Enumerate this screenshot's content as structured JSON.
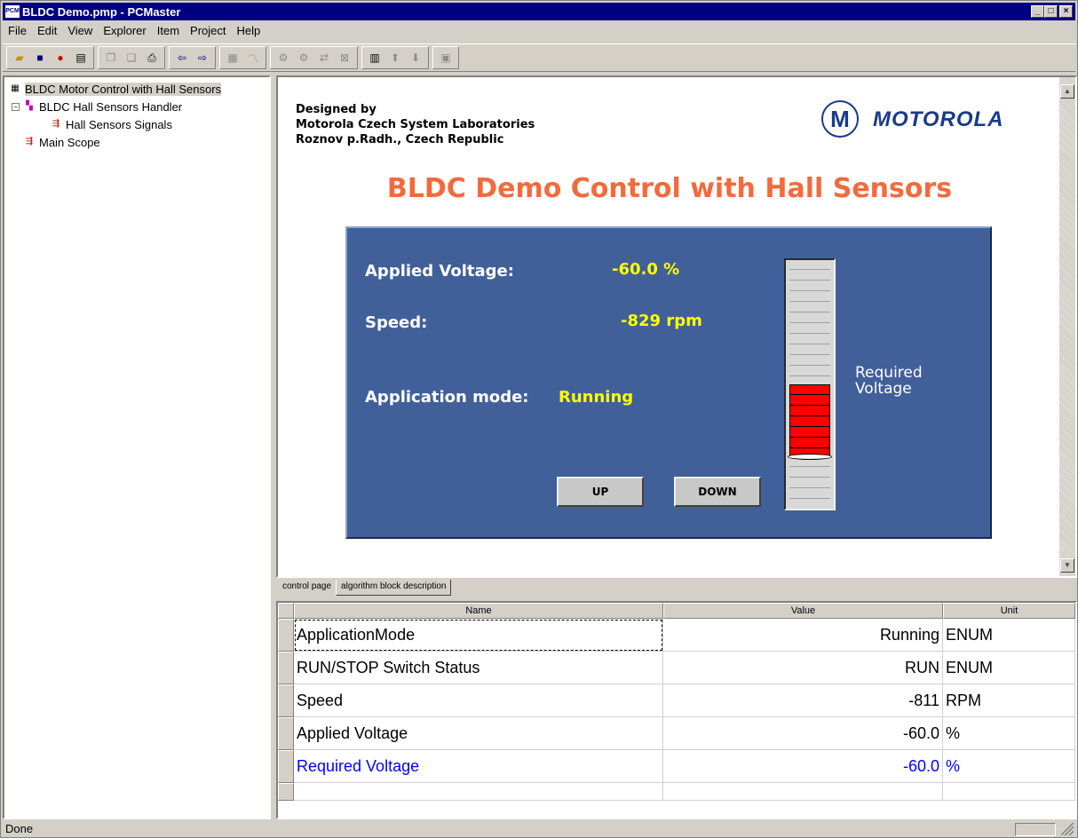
{
  "window": {
    "title": "BLDC Demo.pmp - PCMaster",
    "app_icon": "PCM"
  },
  "menu": [
    "File",
    "Edit",
    "View",
    "Explorer",
    "Item",
    "Project",
    "Help"
  ],
  "tree": {
    "root": "BLDC Motor Control with Hall Sensors",
    "handler": "BLDC Hall Sensors Handler",
    "signals": "Hall Sensors Signals",
    "scope": "Main Scope"
  },
  "page": {
    "designed_line1": "Designed by",
    "designed_line2": "Motorola Czech System Laboratories",
    "designed_line3": "Roznov p.Radh., Czech Republic",
    "logo_symbol": "M",
    "logo_text": "MOTOROLA",
    "title": "BLDC Demo Control with Hall Sensors",
    "applied_voltage_label": "Applied Voltage:",
    "applied_voltage_value": "-60.0 %",
    "speed_label": "Speed:",
    "speed_value": "-829 rpm",
    "mode_label": "Application mode:",
    "mode_value": "Running",
    "up_label": "UP",
    "down_label": "DOWN",
    "required_line1": "Required",
    "required_line2": "Voltage"
  },
  "tabs": [
    "control page",
    "algorithm block description"
  ],
  "grid": {
    "headers": [
      "Name",
      "Value",
      "Unit"
    ],
    "rows": [
      {
        "name": "ApplicationMode",
        "value": "Running",
        "unit": "ENUM"
      },
      {
        "name": "RUN/STOP Switch Status",
        "value": "RUN",
        "unit": "ENUM"
      },
      {
        "name": "Speed",
        "value": "-811",
        "unit": "RPM"
      },
      {
        "name": "Applied Voltage",
        "value": "-60.0",
        "unit": "%"
      },
      {
        "name": "Required Voltage",
        "value": "-60.0",
        "unit": "%"
      }
    ]
  },
  "status": "Done",
  "colors": {
    "title_orange": "#f26b3c",
    "panel_blue": "#41609a",
    "value_yellow": "#ffff00",
    "watch_blue": "#0000ff"
  }
}
